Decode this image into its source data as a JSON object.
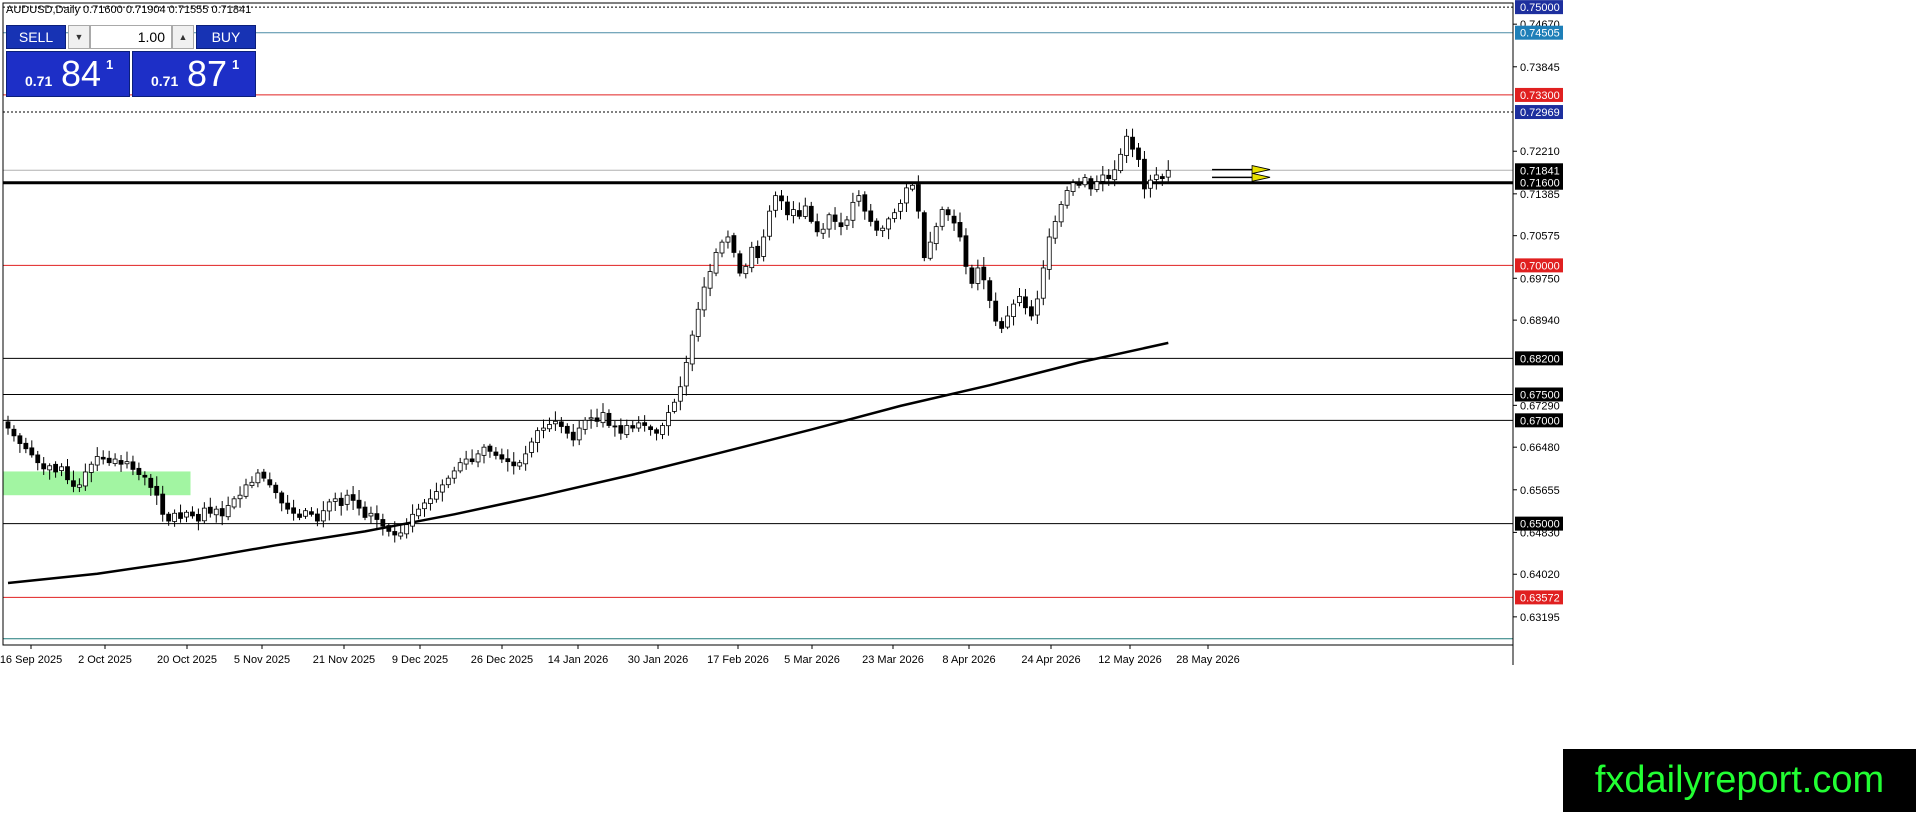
{
  "window": {
    "symbol_title": "AUDUSD,Daily  0.71600 0.71904 0.71555 0.71841"
  },
  "trade_panel": {
    "sell_label": "SELL",
    "buy_label": "BUY",
    "volume": "1.00",
    "sell_price_prefix": "0.71",
    "sell_price_big": "84",
    "sell_price_sup": "1",
    "buy_price_prefix": "0.71",
    "buy_price_big": "87",
    "buy_price_sup": "1",
    "colors": {
      "button": "#1733b4",
      "quote": "#1d2fc7"
    }
  },
  "brand": {
    "text": "fxdailyreport.com",
    "bg": "#000000",
    "color": "#22ff33"
  },
  "chart_data": {
    "type": "candlestick",
    "symbol": "AUDUSD",
    "timeframe": "Daily",
    "header_ohlc": {
      "open": 0.716,
      "high": 0.71904,
      "low": 0.71555,
      "close": 0.71841
    },
    "ylim": [
      0.6265,
      0.7508
    ],
    "y_ticks": [
      "0.74670",
      "0.73845",
      "0.72210",
      "0.71385",
      "0.70575",
      "0.69750",
      "0.68940",
      "0.67290",
      "0.66480",
      "0.65655",
      "0.64830",
      "0.64020",
      "0.63195"
    ],
    "price_labels": [
      {
        "text": "0.75000",
        "value": 0.75,
        "bg": "#1d2f9e",
        "fg": "#ffffff",
        "line": "#000000",
        "dash": "2,2"
      },
      {
        "text": "0.74505",
        "value": 0.74505,
        "bg": "#1e7fb8",
        "fg": "#ffffff",
        "line": "#4a8ca5",
        "dash": ""
      },
      {
        "text": "0.73300",
        "value": 0.733,
        "bg": "#e02020",
        "fg": "#ffffff",
        "line": "#e02020",
        "dash": ""
      },
      {
        "text": "0.72969",
        "value": 0.72969,
        "bg": "#1d2f9e",
        "fg": "#ffffff",
        "line": "#000000",
        "dash": "2,2"
      },
      {
        "text": "0.71841",
        "value": 0.71841,
        "bg": "#000000",
        "fg": "#ffffff",
        "line": "#b0b0b0",
        "dash": ""
      },
      {
        "text": "0.71600",
        "value": 0.716,
        "bg": "#000000",
        "fg": "#ffffff",
        "line": "#000000",
        "dash": "",
        "width": 3
      },
      {
        "text": "0.70000",
        "value": 0.7,
        "bg": "#e02020",
        "fg": "#ffffff",
        "line": "#e02020",
        "dash": ""
      },
      {
        "text": "0.68200",
        "value": 0.682,
        "bg": "#000000",
        "fg": "#ffffff",
        "line": "#000000",
        "dash": ""
      },
      {
        "text": "0.67500",
        "value": 0.675,
        "bg": "#000000",
        "fg": "#ffffff",
        "line": "#000000",
        "dash": ""
      },
      {
        "text": "0.67000",
        "value": 0.67,
        "bg": "#000000",
        "fg": "#ffffff",
        "line": "#000000",
        "dash": ""
      },
      {
        "text": "0.65000",
        "value": 0.65,
        "bg": "#000000",
        "fg": "#ffffff",
        "line": "#000000",
        "dash": ""
      },
      {
        "text": "0.63572",
        "value": 0.63572,
        "bg": "#e02020",
        "fg": "#ffffff",
        "line": "#e02020",
        "dash": ""
      }
    ],
    "bottom_line": {
      "value": 0.6277,
      "color": "#1f7a7a"
    },
    "x_labels": [
      "16 Sep 2025",
      "2 Oct 2025",
      "20 Oct 2025",
      "5 Nov 2025",
      "21 Nov 2025",
      "9 Dec 2025",
      "26 Dec 2025",
      "14 Jan 2026",
      "30 Jan 2026",
      "17 Feb 2026",
      "5 Mar 2026",
      "23 Mar 2026",
      "8 Apr 2026",
      "24 Apr 2026",
      "12 May 2026",
      "28 May 2026"
    ],
    "candle_count": 195,
    "candle_closes": [
      0.6685,
      0.667,
      0.6655,
      0.6645,
      0.6633,
      0.6618,
      0.6606,
      0.6612,
      0.66,
      0.661,
      0.6585,
      0.6572,
      0.6575,
      0.66,
      0.6615,
      0.663,
      0.6625,
      0.6618,
      0.6625,
      0.6615,
      0.662,
      0.6605,
      0.6595,
      0.659,
      0.657,
      0.6555,
      0.6518,
      0.6505,
      0.652,
      0.651,
      0.6522,
      0.6515,
      0.6505,
      0.653,
      0.652,
      0.6528,
      0.6515,
      0.6535,
      0.6548,
      0.6555,
      0.6575,
      0.658,
      0.6598,
      0.6588,
      0.6575,
      0.656,
      0.654,
      0.6528,
      0.652,
      0.6512,
      0.6525,
      0.6518,
      0.6505,
      0.6525,
      0.6542,
      0.6548,
      0.6535,
      0.6555,
      0.6545,
      0.653,
      0.6512,
      0.652,
      0.6508,
      0.6495,
      0.6485,
      0.6478,
      0.6482,
      0.6498,
      0.6518,
      0.6528,
      0.654,
      0.6548,
      0.6562,
      0.6575,
      0.6588,
      0.6602,
      0.6618,
      0.6625,
      0.662,
      0.6635,
      0.6648,
      0.664,
      0.6632,
      0.6625,
      0.662,
      0.6612,
      0.6618,
      0.6635,
      0.6658,
      0.668,
      0.6685,
      0.6692,
      0.6698,
      0.6688,
      0.6675,
      0.6662,
      0.6685,
      0.67,
      0.6705,
      0.6698,
      0.6715,
      0.669,
      0.6688,
      0.6675,
      0.669,
      0.6685,
      0.6695,
      0.669,
      0.6682,
      0.6675,
      0.669,
      0.6715,
      0.6735,
      0.6765,
      0.6812,
      0.6865,
      0.6915,
      0.6958,
      0.6988,
      0.7025,
      0.7045,
      0.7055,
      0.7025,
      0.6985,
      0.6998,
      0.7035,
      0.7015,
      0.7055,
      0.7105,
      0.7135,
      0.7125,
      0.7098,
      0.7108,
      0.7095,
      0.7115,
      0.7085,
      0.7065,
      0.707,
      0.7098,
      0.7085,
      0.7075,
      0.7088,
      0.7122,
      0.7135,
      0.7105,
      0.7085,
      0.7068,
      0.7072,
      0.709,
      0.7102,
      0.712,
      0.715,
      0.7155,
      0.7105,
      0.7015,
      0.7045,
      0.7075,
      0.7108,
      0.7098,
      0.7082,
      0.7055,
      0.6998,
      0.6965,
      0.6995,
      0.6972,
      0.6932,
      0.6892,
      0.6878,
      0.6902,
      0.6925,
      0.694,
      0.6918,
      0.6902,
      0.6935,
      0.6995,
      0.7055,
      0.7085,
      0.7118,
      0.7145,
      0.716,
      0.7155,
      0.717,
      0.7148,
      0.7162,
      0.7175,
      0.7168,
      0.7185,
      0.7215,
      0.725,
      0.7225,
      0.7205,
      0.7148,
      0.7165,
      0.7175,
      0.7168,
      0.7184
    ],
    "moving_average": {
      "color": "#000000",
      "points": [
        [
          0,
          0.6385
        ],
        [
          15,
          0.6403
        ],
        [
          30,
          0.6428
        ],
        [
          45,
          0.6458
        ],
        [
          60,
          0.6485
        ],
        [
          75,
          0.6518
        ],
        [
          90,
          0.6555
        ],
        [
          105,
          0.6595
        ],
        [
          120,
          0.6638
        ],
        [
          135,
          0.6682
        ],
        [
          150,
          0.6728
        ],
        [
          165,
          0.6768
        ],
        [
          180,
          0.6812
        ],
        [
          195,
          0.685
        ]
      ]
    },
    "support_zone": {
      "value_top": 0.6601,
      "value_bottom": 0.6555,
      "candle_from": 0,
      "candle_to": 30,
      "color": "#a2f5a2"
    },
    "arrows": [
      {
        "candle": 199,
        "value": 0.71855,
        "color": "#e8e000"
      },
      {
        "candle": 199,
        "value": 0.71705,
        "color": "#e8e000"
      }
    ],
    "colors": {
      "bull_body": "#ffffff",
      "bear_body": "#000000",
      "wick": "#000000"
    }
  }
}
